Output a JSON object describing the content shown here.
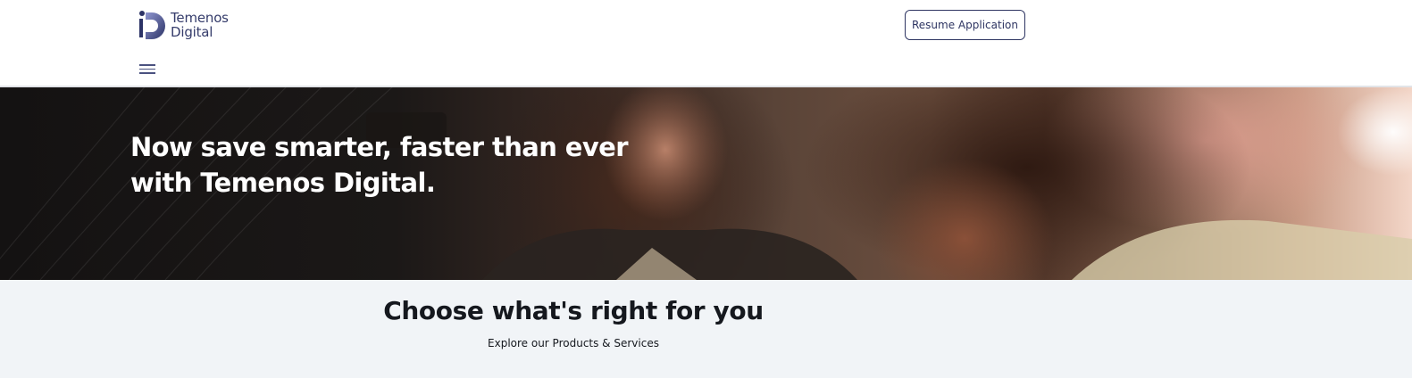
{
  "header": {
    "logo": {
      "line1": "Temenos",
      "line2": "Digital"
    },
    "resume_label": "Resume Application"
  },
  "hero": {
    "title": "Now save smarter, faster than ever with Temenos Digital."
  },
  "products": {
    "title": "Choose what's right for you",
    "subtitle": "Explore our Products & Services"
  },
  "colors": {
    "brand": "#2e3562",
    "section_bg": "#f1f4f7",
    "hero_text": "#ffffff"
  },
  "icons": {
    "logo": "temenos-d-logo-icon",
    "menu": "hamburger-menu-icon"
  }
}
